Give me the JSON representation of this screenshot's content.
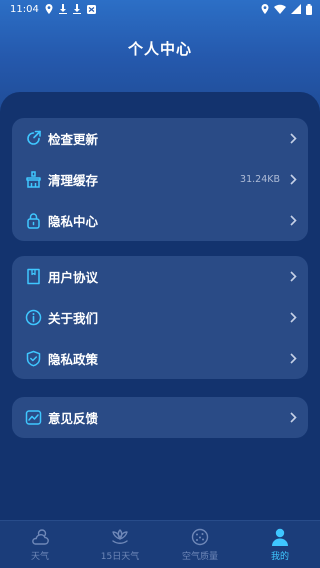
{
  "status_bar": {
    "time": "11:04",
    "left_icons": [
      "location-pin-icon",
      "download-icon",
      "download-icon",
      "notification-app-icon"
    ],
    "right_icons": [
      "location-icon",
      "wifi-icon",
      "signal-icon",
      "battery-icon"
    ]
  },
  "header": {
    "title": "个人中心"
  },
  "menu_groups": [
    [
      {
        "name": "check-update",
        "icon": "refresh-arrow-icon",
        "label": "检查更新",
        "value": ""
      },
      {
        "name": "clear-cache",
        "icon": "broom-icon",
        "label": "清理缓存",
        "value": "31.24KB"
      },
      {
        "name": "privacy-center",
        "icon": "lock-icon",
        "label": "隐私中心",
        "value": ""
      }
    ],
    [
      {
        "name": "user-agreement",
        "icon": "document-icon",
        "label": "用户协议",
        "value": ""
      },
      {
        "name": "about-us",
        "icon": "info-icon",
        "label": "关于我们",
        "value": ""
      },
      {
        "name": "privacy-policy",
        "icon": "shield-check-icon",
        "label": "隐私政策",
        "value": ""
      }
    ],
    [
      {
        "name": "feedback",
        "icon": "chart-feedback-icon",
        "label": "意见反馈",
        "value": ""
      }
    ]
  ],
  "bottom_nav": {
    "items": [
      {
        "name": "weather",
        "icon": "cloud-sun-icon",
        "label": "天气",
        "active": false
      },
      {
        "name": "15-day-weather",
        "icon": "lotus-icon",
        "label": "15日天气",
        "active": false
      },
      {
        "name": "air-quality",
        "icon": "dotted-circle-icon",
        "label": "空气质量",
        "active": false
      },
      {
        "name": "mine",
        "icon": "user-icon",
        "label": "我的",
        "active": true
      }
    ]
  },
  "colors": {
    "accent": "#3fc7ff",
    "card": "#2a4b86",
    "panel": "#13336e",
    "nav_inactive": "#6f88b8"
  }
}
